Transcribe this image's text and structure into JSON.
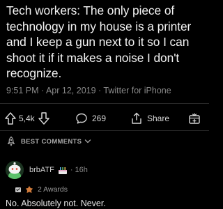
{
  "tweet": {
    "lines": [
      "Tech workers: The only piece of",
      "technology in my house is a printer",
      "and I keep a gun next to it so I can",
      "shoot it if it makes a noise I don't",
      "recognize."
    ],
    "meta": "9:51 PM · Apr 12, 2019 · Twitter for iPhone"
  },
  "actions": {
    "vote_count": "5,4k",
    "comment_count": "269",
    "share_label": "Share"
  },
  "sort": {
    "label": "BEST COMMENTS"
  },
  "comment": {
    "username": "brbATF",
    "separator": "·",
    "time": "16h",
    "awards_label": "2 Awards",
    "body": "No. Absolutely not. Never."
  },
  "icons": {
    "upvote": "upvote-arrow-icon",
    "downvote": "downvote-arrow-icon",
    "comments": "comment-bubble-icon",
    "share": "share-icon",
    "award": "award-add-icon",
    "sort": "rocket-icon",
    "chevron": "chevron-down-icon",
    "avatar": "snoo-avatar-icon"
  },
  "colors": {
    "background": "#000000",
    "text": "#f2f2f2",
    "muted": "#8a8a8a",
    "avatar_green": "#5bc16a"
  }
}
